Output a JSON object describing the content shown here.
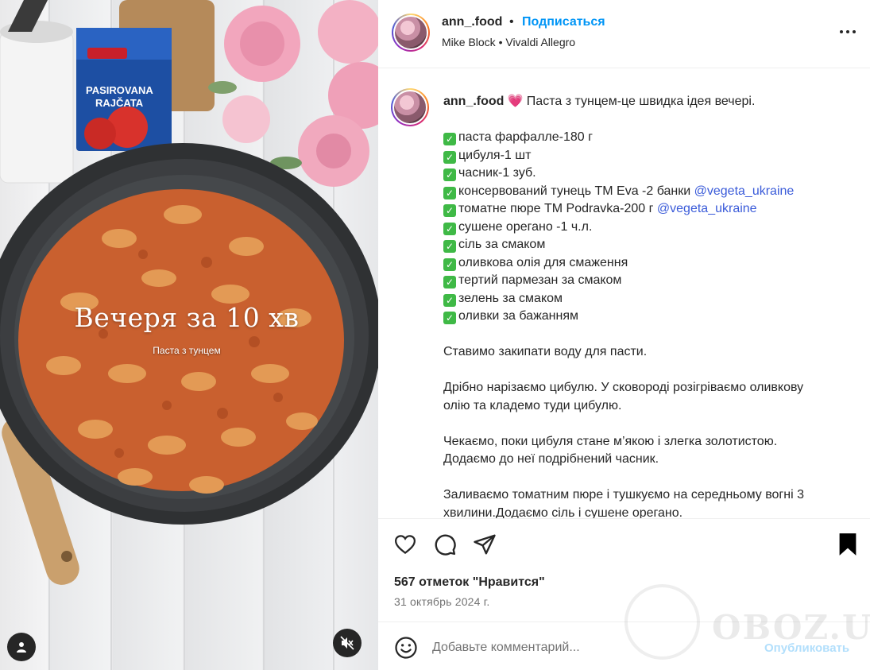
{
  "post": {
    "overlay_title": "Вечеря за 10 хв",
    "overlay_subtitle": "Паста з тунцем"
  },
  "header": {
    "username": "ann_.food",
    "separator": "•",
    "follow_label": "Подписаться",
    "music": "Mike Block • Vivaldi Allegro"
  },
  "caption": {
    "username": "ann_.food",
    "intro": "💗 Паста з тунцем-це швидка ідея вечері.",
    "ingredients": [
      {
        "text": "паста фарфалле-180 г",
        "mention": ""
      },
      {
        "text": "цибуля-1 шт",
        "mention": ""
      },
      {
        "text": "часник-1 зуб.",
        "mention": ""
      },
      {
        "text": "консервований тунець ТМ Eva -2 банки ",
        "mention": "@vegeta_ukraine"
      },
      {
        "text": "томатне пюре ТМ Podravka-200 г ",
        "mention": "@vegeta_ukraine"
      },
      {
        "text": "сушене орегано -1 ч.л.",
        "mention": ""
      },
      {
        "text": "сіль за смаком",
        "mention": ""
      },
      {
        "text": "оливкова олія для смаження",
        "mention": ""
      },
      {
        "text": "тертий пармезан за смаком",
        "mention": ""
      },
      {
        "text": "зелень за смаком",
        "mention": ""
      },
      {
        "text": "оливки за бажанням",
        "mention": ""
      }
    ],
    "steps": [
      [
        "Ставимо закипати воду для пасти."
      ],
      [
        "Дрібно нарізаємо цибулю. У сковороді розігріваємо оливкову",
        "олію та кладемо туди цибулю."
      ],
      [
        "Чекаємо, поки цибуля стане м’якою і злегка золотистою.",
        "Додаємо до неї подрібнений часник."
      ],
      [
        "Заливаємо томатним пюре і тушкуємо на середньому вогні 3",
        "хвилини.Додаємо сіль і сушене орегано."
      ]
    ]
  },
  "actions": {
    "likes": "567 отметок \"Нравится\"",
    "date": "31 октябрь 2024 г."
  },
  "comment": {
    "placeholder": "Добавьте комментарий...",
    "publish_label": "Опубликовать"
  },
  "watermark": {
    "text": "OBOZ.UA"
  },
  "colors": {
    "accent": "#0095f6",
    "mention": "#3a5bd9",
    "check": "#3fb946"
  }
}
